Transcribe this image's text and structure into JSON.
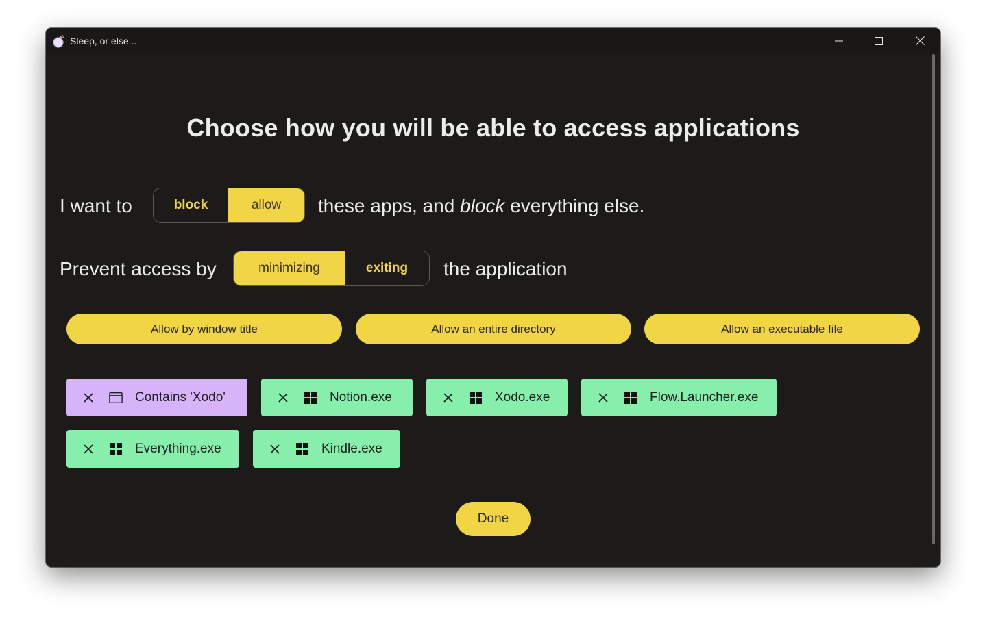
{
  "window": {
    "title": "Sleep, or else...",
    "app_icon": "bomb-icon"
  },
  "heading": "Choose how you will be able to access applications",
  "mode_row": {
    "prefix": "I want to",
    "options": [
      "block",
      "allow"
    ],
    "selected": "allow",
    "suffix_start": "these apps, and ",
    "suffix_emphasis": "block",
    "suffix_end": " everything else."
  },
  "method_row": {
    "prefix": "Prevent access by",
    "options": [
      "minimizing",
      "exiting"
    ],
    "selected": "minimizing",
    "suffix": "the application"
  },
  "actions": {
    "by_title": "Allow by window title",
    "by_directory": "Allow an entire directory",
    "by_executable": "Allow an executable file"
  },
  "rules": [
    {
      "label": "Contains 'Xodo'",
      "kind": "window-title",
      "icon": "window-icon",
      "color": "#d7b4fa"
    },
    {
      "label": "Notion.exe",
      "kind": "executable",
      "icon": "windows-logo-icon",
      "color": "#86efac"
    },
    {
      "label": "Xodo.exe",
      "kind": "executable",
      "icon": "windows-logo-icon",
      "color": "#86efac"
    },
    {
      "label": "Flow.Launcher.exe",
      "kind": "executable",
      "icon": "windows-logo-icon",
      "color": "#86efac"
    },
    {
      "label": "Everything.exe",
      "kind": "executable",
      "icon": "windows-logo-icon",
      "color": "#86efac"
    },
    {
      "label": "Kindle.exe",
      "kind": "executable",
      "icon": "windows-logo-icon",
      "color": "#86efac"
    }
  ],
  "done_label": "Done",
  "colors": {
    "accent": "#f1d544",
    "background": "#1c1b1a",
    "chip_green": "#86efac",
    "chip_purple": "#d7b4fa"
  }
}
